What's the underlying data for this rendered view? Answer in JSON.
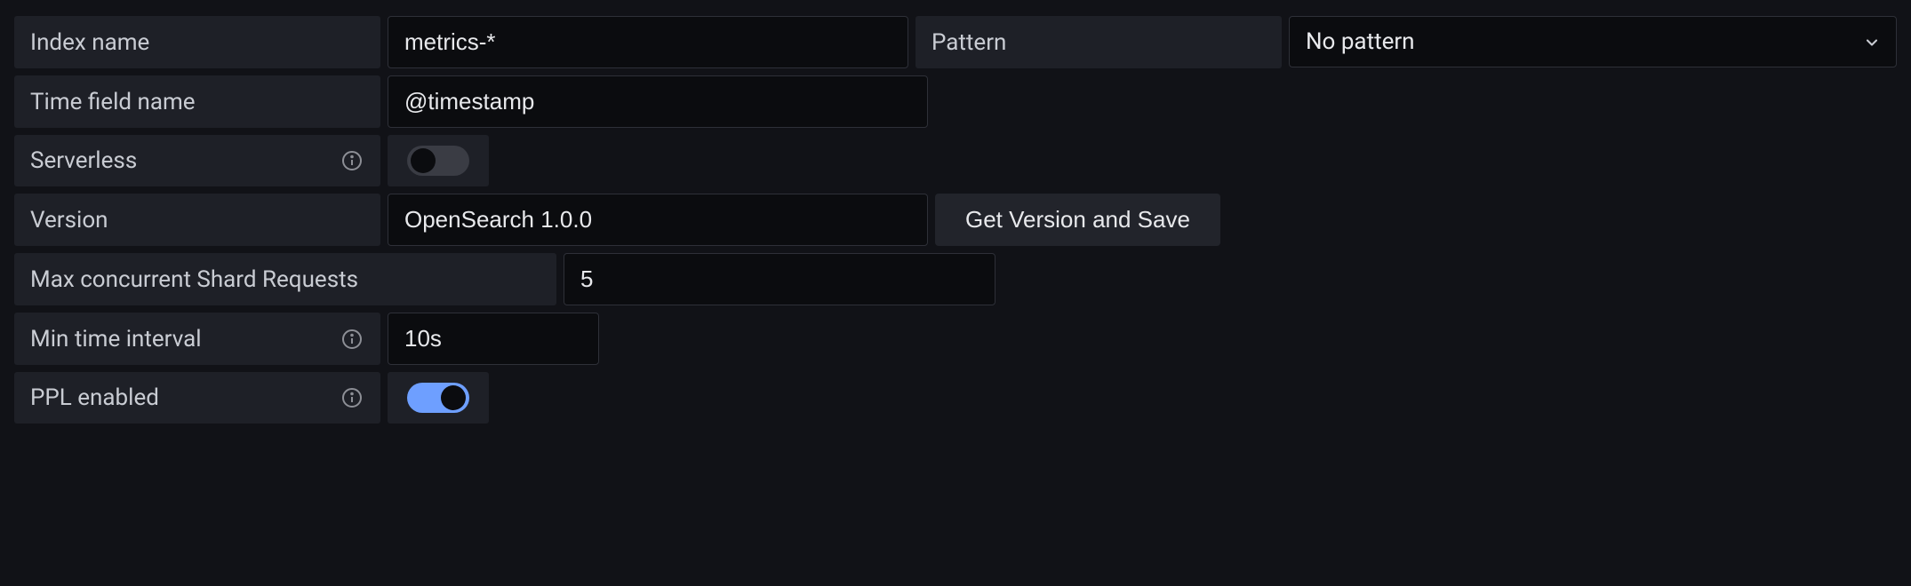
{
  "fields": {
    "index_name": {
      "label": "Index name",
      "value": "metrics-*"
    },
    "pattern": {
      "label": "Pattern",
      "selected": "No pattern"
    },
    "time_field_name": {
      "label": "Time field name",
      "value": "@timestamp"
    },
    "serverless": {
      "label": "Serverless",
      "enabled": false
    },
    "version": {
      "label": "Version",
      "value": "OpenSearch 1.0.0"
    },
    "get_version_button": "Get Version and Save",
    "max_concurrent_shard_requests": {
      "label": "Max concurrent Shard Requests",
      "value": "5"
    },
    "min_time_interval": {
      "label": "Min time interval",
      "value": "10s"
    },
    "ppl_enabled": {
      "label": "PPL enabled",
      "enabled": true
    }
  }
}
